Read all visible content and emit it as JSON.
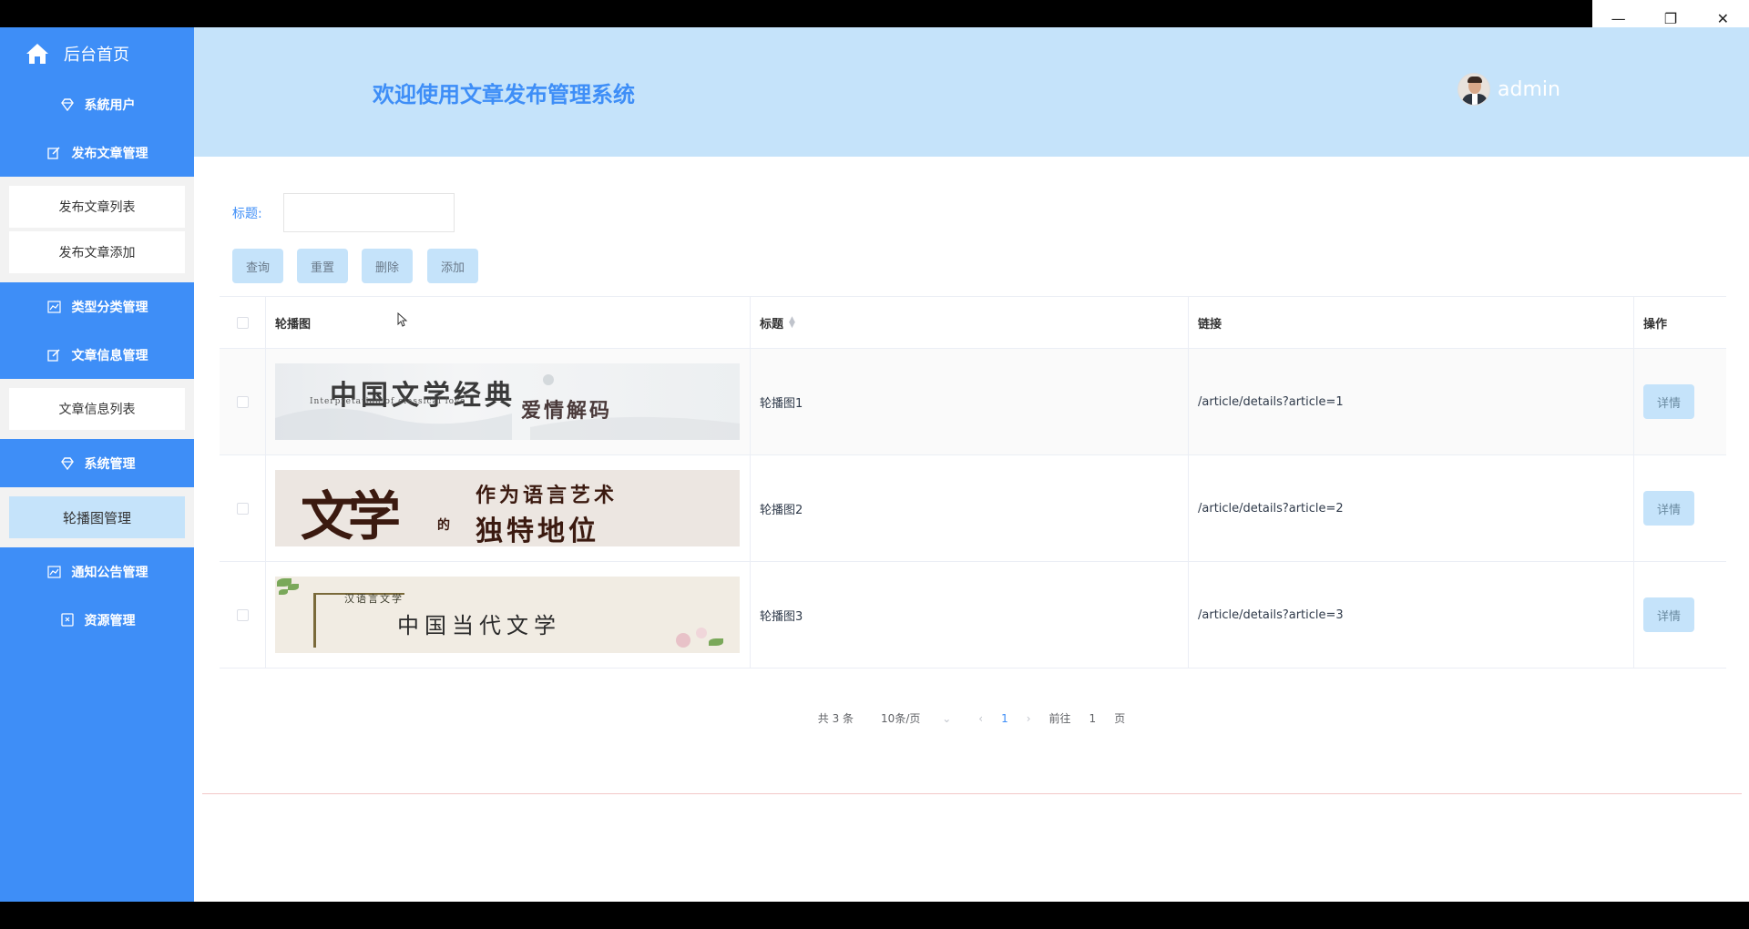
{
  "window": {
    "minimize": "—",
    "maximize": "❐",
    "close": "✕"
  },
  "sidebar": {
    "home": "后台首页",
    "items": [
      {
        "type": "group",
        "label": "系統用户",
        "icon": "diamond-icon"
      },
      {
        "type": "group",
        "label": "发布文章管理",
        "icon": "edit-icon"
      },
      {
        "type": "sub",
        "label": "发布文章列表"
      },
      {
        "type": "sub",
        "label": "发布文章添加"
      },
      {
        "type": "group",
        "label": "类型分类管理",
        "icon": "chart-icon"
      },
      {
        "type": "group",
        "label": "文章信息管理",
        "icon": "edit-icon"
      },
      {
        "type": "sub",
        "label": "文章信息列表"
      },
      {
        "type": "group",
        "label": "系统管理",
        "icon": "diamond-icon"
      },
      {
        "type": "sub",
        "label": "轮播图管理",
        "active": true
      },
      {
        "type": "group",
        "label": "通知公告管理",
        "icon": "chart-icon"
      },
      {
        "type": "group",
        "label": "资源管理",
        "icon": "resource-icon"
      }
    ]
  },
  "header": {
    "title": "欢迎使用文章发布管理系统",
    "username": "admin"
  },
  "search": {
    "label": "标题:",
    "value": ""
  },
  "toolbar": {
    "query": "查询",
    "reset": "重置",
    "delete": "删除",
    "add": "添加"
  },
  "table": {
    "columns": {
      "image": "轮播图",
      "title": "标题",
      "link": "链接",
      "ops": "操作"
    },
    "rows": [
      {
        "banner": {
          "line1": "中国文学经典",
          "line2": "Interpretation of classical love",
          "line3": "爱情解码"
        },
        "title": "轮播图1",
        "link": "/article/details?article=1",
        "op": "详情"
      },
      {
        "banner": {
          "line1": "文学",
          "line2": "作为语言艺术",
          "line3": "独特地位",
          "line4": "的"
        },
        "title": "轮播图2",
        "link": "/article/details?article=2",
        "op": "详情"
      },
      {
        "banner": {
          "line1": "汉语言文学",
          "line2": "中国当代文学"
        },
        "title": "轮播图3",
        "link": "/article/details?article=3",
        "op": "详情"
      }
    ]
  },
  "pagination": {
    "total": "共 3 条",
    "page_size": "10条/页",
    "prev": "‹",
    "current": "1",
    "next": "›",
    "goto_prefix": "前往",
    "goto_value": "1",
    "goto_suffix": "页"
  },
  "colors": {
    "primary": "#3e8ef7",
    "header_bg": "#c5e3fa"
  }
}
